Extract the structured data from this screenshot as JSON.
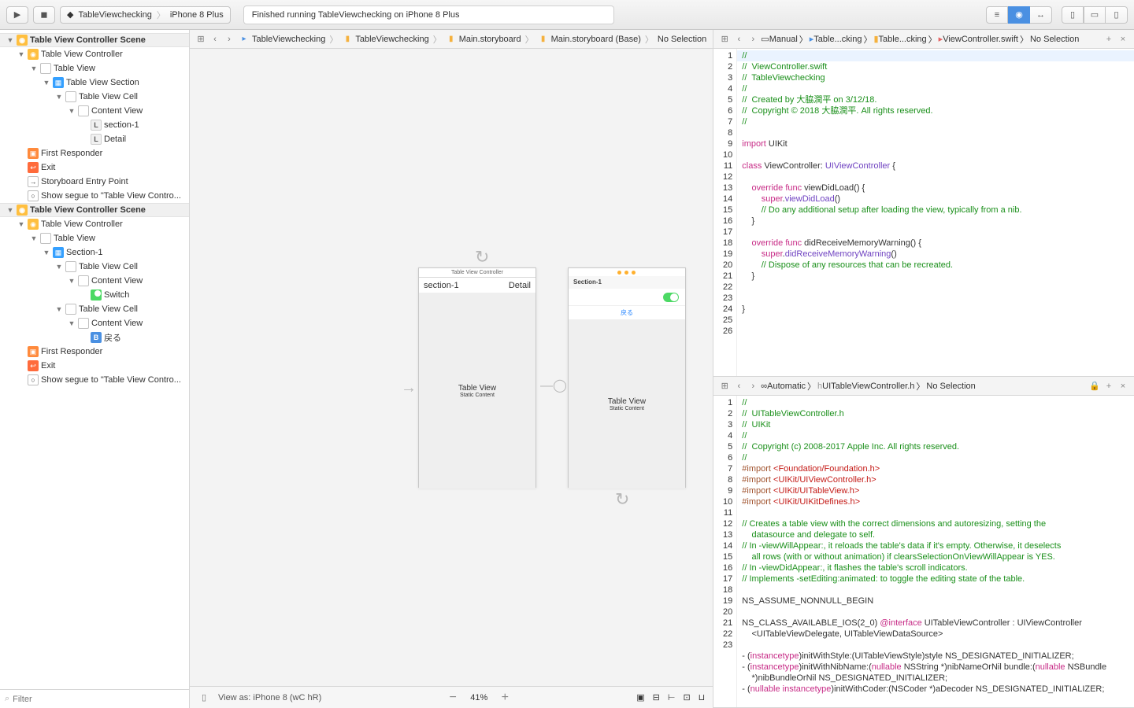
{
  "toolbar": {
    "scheme_app": "TableViewchecking",
    "scheme_dest": "iPhone 8 Plus",
    "status": "Finished running TableViewchecking on iPhone 8 Plus"
  },
  "jumpbar_left": {
    "items": [
      "TableViewchecking",
      "TableViewchecking",
      "Main.storyboard",
      "Main.storyboard (Base)",
      "No Selection"
    ]
  },
  "outline": {
    "scene1_title": "Table View Controller Scene",
    "scene2_title": "Table View Controller Scene",
    "tvc": "Table View Controller",
    "tv": "Table View",
    "tvs": "Table View Section",
    "tvcll": "Table View Cell",
    "cv": "Content View",
    "section1_lbl": "section-1",
    "detail_lbl": "Detail",
    "section1_node": "Section-1",
    "switch_lbl": "Switch",
    "back_lbl": "戻る",
    "first_responder": "First Responder",
    "exit": "Exit",
    "entry": "Storyboard Entry Point",
    "segue": "Show segue to \"Table View Contro...",
    "filter_placeholder": "Filter"
  },
  "canvas": {
    "dev1_title": "Table View Controller",
    "dev1_section": "section-1",
    "dev1_detail": "Detail",
    "tv_label": "Table View",
    "tv_sub": "Static Content",
    "dev2_section": "Section-1",
    "dev2_back": "戻る"
  },
  "footer": {
    "viewas": "View as: iPhone 8 (wC hR)",
    "zoom": "41%"
  },
  "asst_top": {
    "jb_mode": "Manual",
    "jb_items": [
      "Table...cking",
      "Table...cking",
      "ViewController.swift",
      "No Selection"
    ]
  },
  "asst_bot": {
    "jb_mode": "Automatic",
    "jb_items": [
      "UITableViewController.h",
      "No Selection"
    ]
  },
  "code_top": {
    "gutter": [
      "1",
      "2",
      "3",
      "4",
      "5",
      "6",
      "7",
      "8",
      "9",
      "10",
      "11",
      "12",
      "13",
      "14",
      "15",
      "16",
      "17",
      "18",
      "19",
      "20",
      "21",
      "22",
      "23",
      "24",
      "25",
      "26"
    ]
  },
  "code_bot": {
    "gutter": [
      "1",
      "2",
      "3",
      "4",
      "5",
      "6",
      "7",
      "8",
      "9",
      "10",
      "11",
      "12",
      "13",
      "14",
      "15",
      "16",
      "17",
      "18",
      "19",
      "20",
      "21",
      "22",
      "23"
    ]
  }
}
